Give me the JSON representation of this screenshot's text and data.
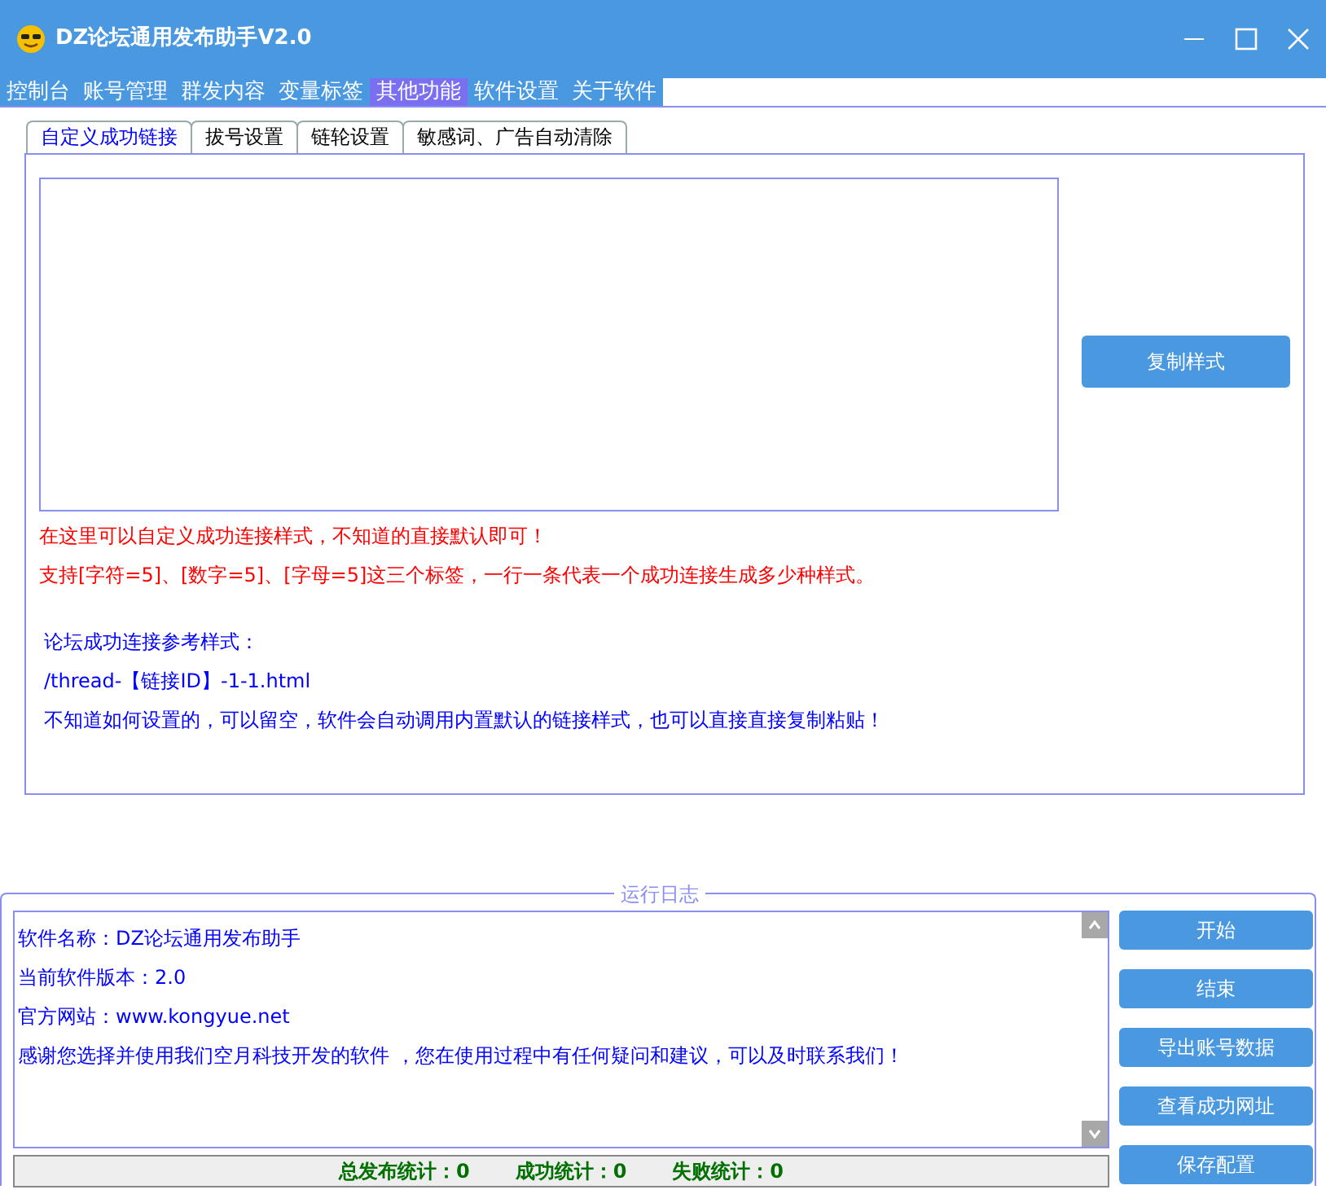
{
  "window": {
    "title": "DZ论坛通用发布助手V2.0"
  },
  "menu": [
    {
      "label": "控制台",
      "selected": false
    },
    {
      "label": "账号管理",
      "selected": false
    },
    {
      "label": "群发内容",
      "selected": false
    },
    {
      "label": "变量标签",
      "selected": false
    },
    {
      "label": "其他功能",
      "selected": true
    },
    {
      "label": "软件设置",
      "selected": false
    },
    {
      "label": "关于软件",
      "selected": false
    }
  ],
  "tabs": [
    {
      "label": "自定义成功链接",
      "selected": true
    },
    {
      "label": "拔号设置",
      "selected": false
    },
    {
      "label": "链轮设置",
      "selected": false
    },
    {
      "label": "敏感词、广告自动清除",
      "selected": false
    }
  ],
  "copy_button": "复制样式",
  "notes": [
    {
      "text": "在这里可以自定义成功连接样式，不知道的直接默认即可！",
      "color": "#ff0000"
    },
    {
      "text": "支持[字符=5]、[数字=5]、[字母=5]这三个标签，一行一条代表一个成功连接生成多少种样式。",
      "color": "#ff0000"
    },
    {
      "text": "论坛成功连接参考样式：",
      "color": "#0000ff"
    },
    {
      "text": "/thread-【链接ID】-1-1.html",
      "color": "#0000ff"
    },
    {
      "text": "不知道如何设置的，可以留空，软件会自动调用内置默认的链接样式，也可以直接直接复制粘贴！",
      "color": "#0000ff"
    }
  ],
  "log": {
    "title": "运行日志",
    "lines": [
      "软件名称：DZ论坛通用发布助手",
      "当前软件版本：2.0",
      "官方网站：www.kongyue.net",
      "感谢您选择并使用我们空月科技开发的软件 ，您在使用过程中有任何疑问和建议，可以及时联系我们！"
    ],
    "stats": [
      "总发布统计：0",
      "成功统计：0",
      "失败统计：0"
    ]
  },
  "buttons": [
    "开始",
    "结束",
    "导出账号数据",
    "查看成功网址",
    "保存配置"
  ]
}
